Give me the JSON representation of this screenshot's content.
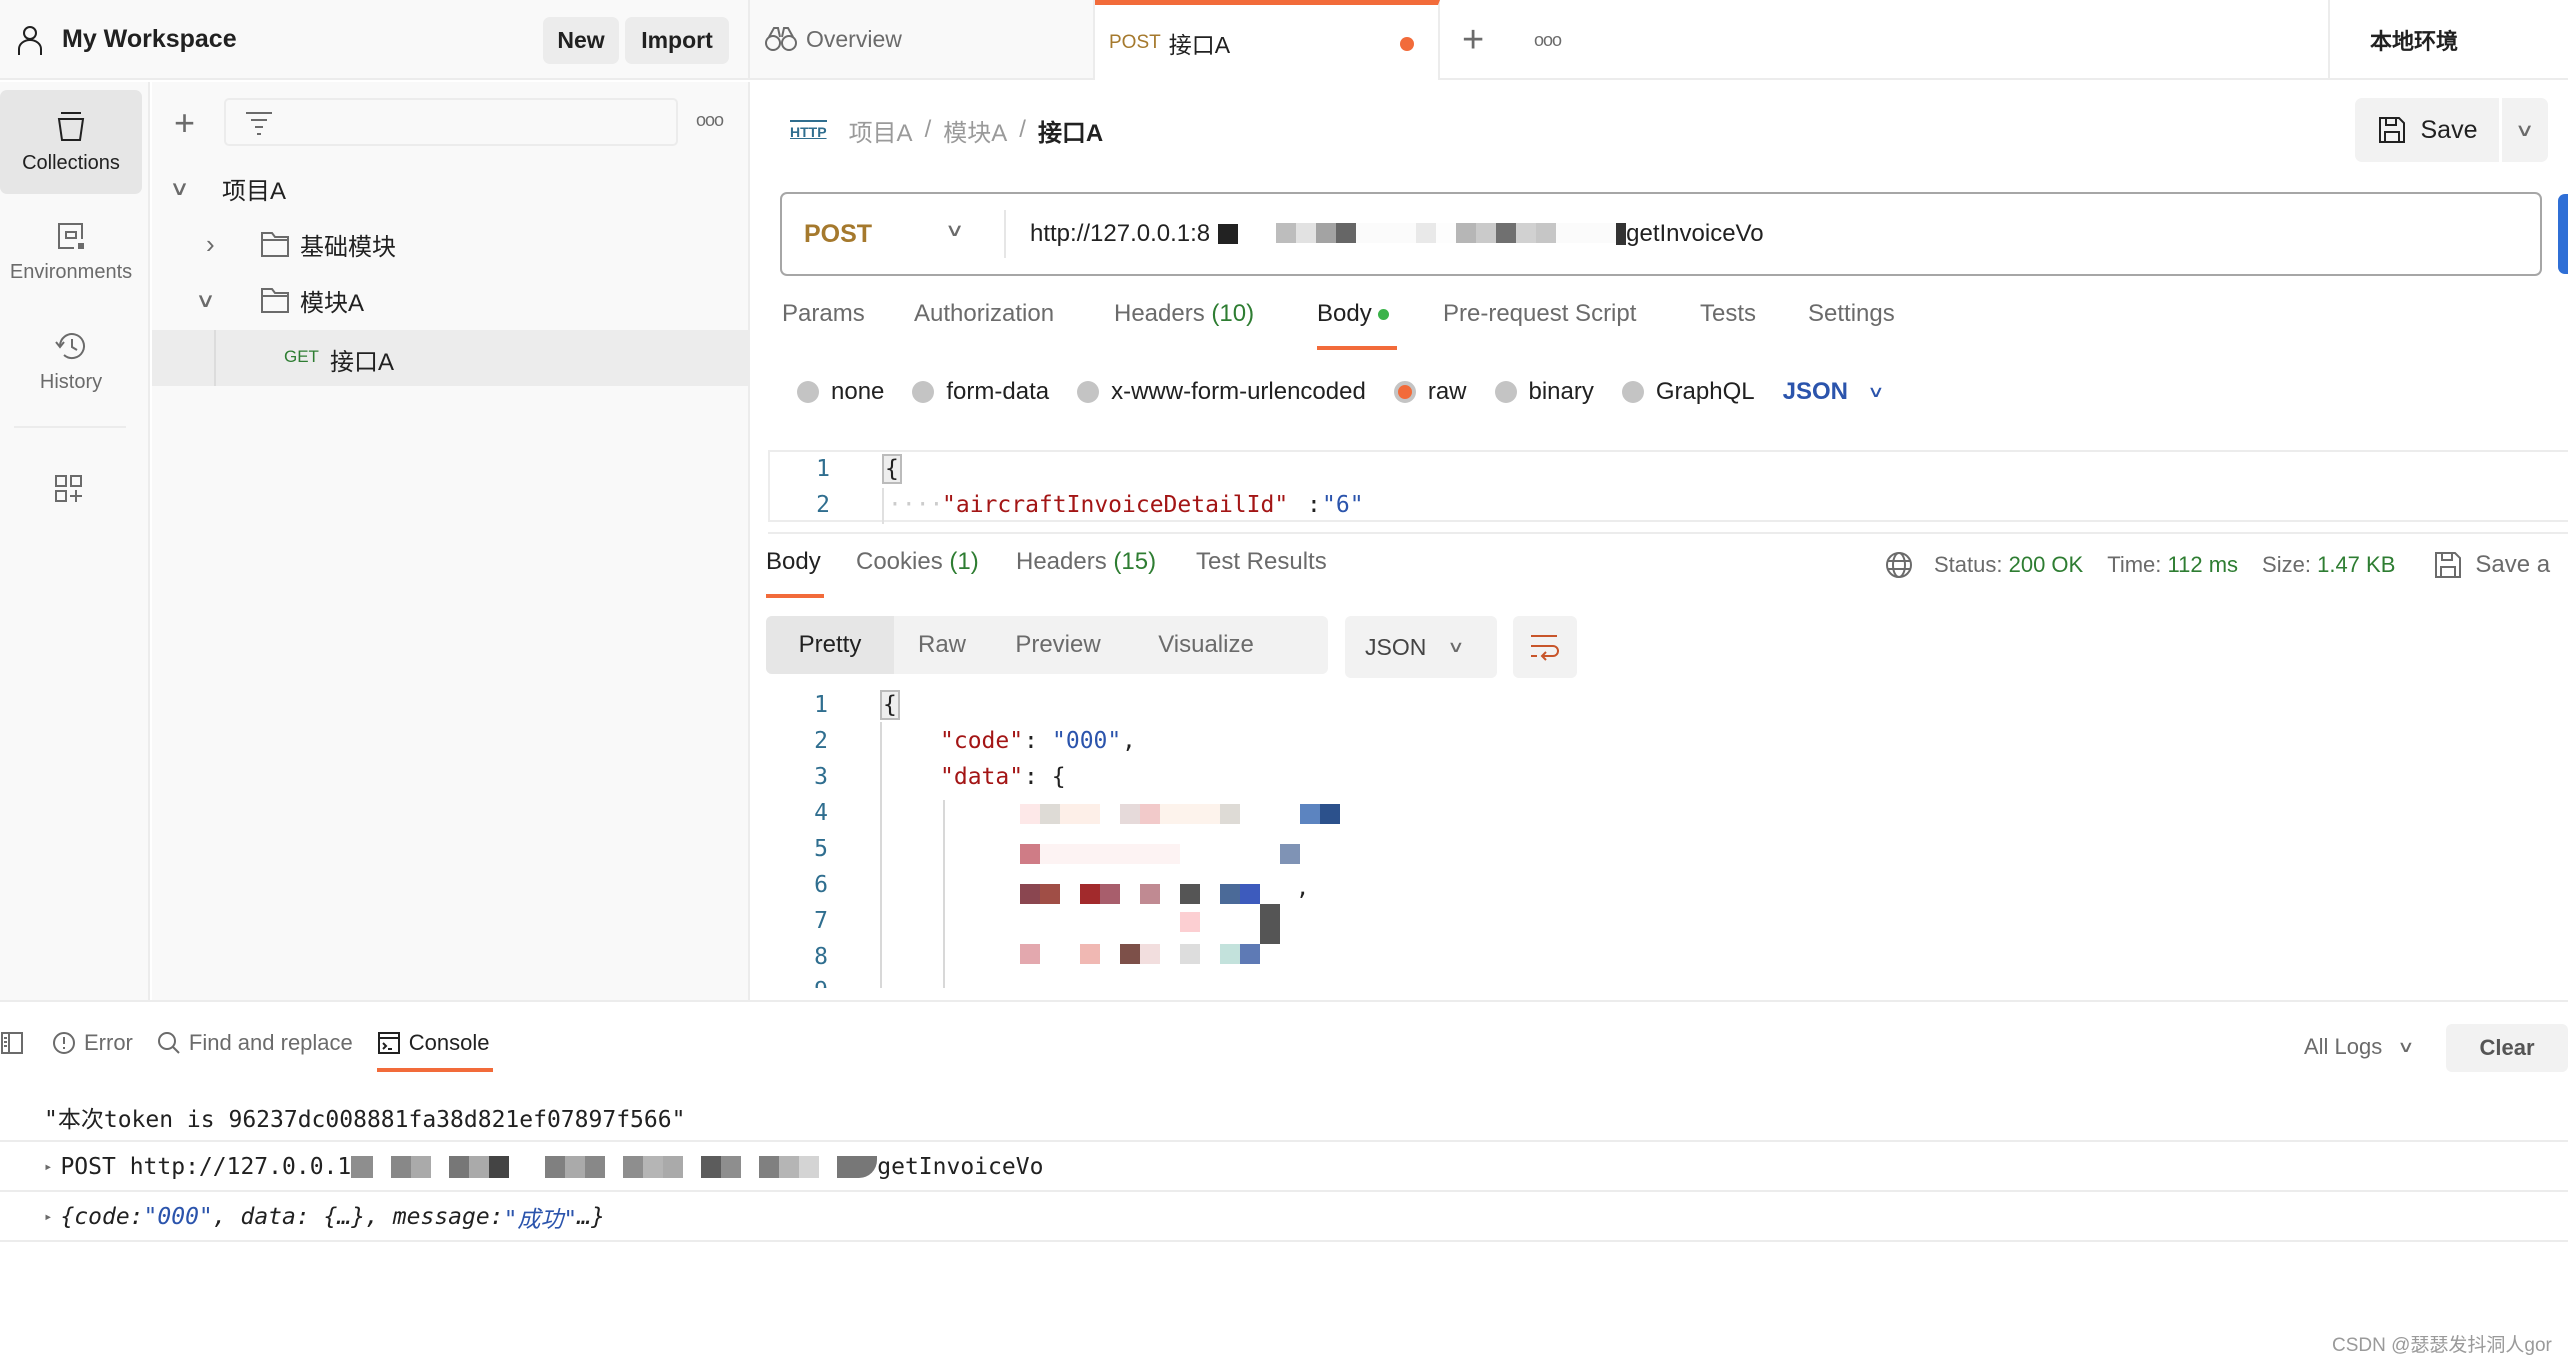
{
  "header": {
    "workspace": "My Workspace",
    "new_label": "New",
    "import_label": "Import"
  },
  "tabs": {
    "overview": "Overview",
    "active_method": "POST",
    "active_name": "接口A",
    "add": "+",
    "more": "ooo",
    "environment": "本地环境"
  },
  "leftnav": {
    "items": [
      {
        "label": "Collections"
      },
      {
        "label": "Environments"
      },
      {
        "label": "History"
      }
    ]
  },
  "collections": {
    "tree": [
      {
        "label": "项目A"
      },
      {
        "label": "基础模块"
      },
      {
        "label": "模块A"
      },
      {
        "method": "GET",
        "label": "接口A"
      }
    ]
  },
  "request": {
    "breadcrumb": {
      "icon": "HTTP",
      "parts": [
        "项目A",
        "模块A",
        "接口A"
      ],
      "sep": "/"
    },
    "save_label": "Save",
    "method": "POST",
    "url_prefix": "http://127.0.0.1:8",
    "url_suffix": "getInvoiceVo",
    "tabs": [
      {
        "label": "Params"
      },
      {
        "label": "Authorization"
      },
      {
        "label": "Headers",
        "count": "(10)"
      },
      {
        "label": "Body"
      },
      {
        "label": "Pre-request Script"
      },
      {
        "label": "Tests"
      },
      {
        "label": "Settings"
      }
    ],
    "body_types": [
      "none",
      "form-data",
      "x-www-form-urlencoded",
      "raw",
      "binary",
      "GraphQL"
    ],
    "body_format": "JSON",
    "body_lines": [
      {
        "n": "1",
        "text": "{"
      },
      {
        "n": "2",
        "key": "\"aircraftInvoiceDetailId\"",
        "colon": ":",
        "val": "\"6\""
      }
    ]
  },
  "response": {
    "tabs": [
      {
        "label": "Body"
      },
      {
        "label": "Cookies",
        "count": "(1)"
      },
      {
        "label": "Headers",
        "count": "(15)"
      },
      {
        "label": "Test Results"
      }
    ],
    "status_label": "Status:",
    "status": "200 OK",
    "time_label": "Time:",
    "time": "112 ms",
    "size_label": "Size:",
    "size": "1.47 KB",
    "save_label": "Save a",
    "views": [
      "Pretty",
      "Raw",
      "Preview",
      "Visualize"
    ],
    "format": "JSON",
    "lines": [
      {
        "n": "1"
      },
      {
        "n": "2"
      },
      {
        "n": "3"
      },
      {
        "n": "4"
      },
      {
        "n": "5"
      },
      {
        "n": "6"
      },
      {
        "n": "7"
      },
      {
        "n": "8"
      }
    ],
    "code_key": "\"code\"",
    "code_val": "\"000\"",
    "data_key": "\"data\""
  },
  "console": {
    "tabs": {
      "error": "Error",
      "find": "Find and replace",
      "console": "Console"
    },
    "filter": "All Logs",
    "clear": "Clear",
    "logs": [
      {
        "text": "\"本次token is 96237dc008881fa38d821ef07897f566\""
      },
      {
        "method": "POST",
        "url_prefix": "http://127.0.0.1",
        "url_suffix": "getInvoiceVo"
      },
      {
        "a": "{code: ",
        "b": "\"000\"",
        "c": ", data: {…}, message: ",
        "d": "\"成功\"",
        "e": "…}"
      }
    ]
  },
  "watermark": "CSDN @瑟瑟发抖洞人gor"
}
